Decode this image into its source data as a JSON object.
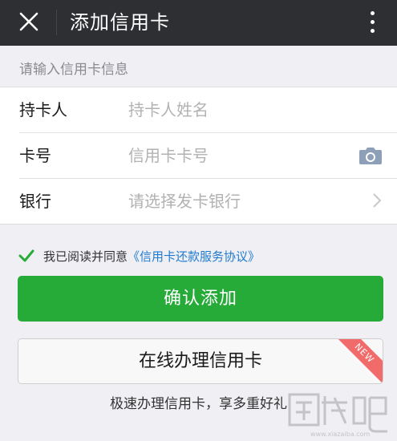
{
  "header": {
    "title": "添加信用卡",
    "close_icon": "close-icon",
    "more_icon": "more-vertical-icon"
  },
  "section_hint": "请输入信用卡信息",
  "form": {
    "rows": [
      {
        "label": "持卡人",
        "placeholder": "持卡人姓名"
      },
      {
        "label": "卡号",
        "placeholder": "信用卡卡号",
        "icon": "camera-icon"
      },
      {
        "label": "银行",
        "placeholder": "请选择发卡银行",
        "icon": "chevron-right-icon"
      }
    ]
  },
  "agreement": {
    "checked": true,
    "text": "我已阅读并同意",
    "link": "《信用卡还款服务协议》"
  },
  "confirm_button": "确认添加",
  "online_button": "在线办理信用卡",
  "new_badge": "NEW",
  "promo_text": "极速办理信用卡，享多重好礼",
  "watermark": {
    "logo_text": "下载吧",
    "url_text": "www.xiazaiba.com"
  },
  "colors": {
    "topbar": "#2e2f33",
    "accent_green": "#26ab38",
    "link_blue": "#1f7bd1",
    "badge_red": "#f16b6b",
    "background": "#efeff4"
  }
}
